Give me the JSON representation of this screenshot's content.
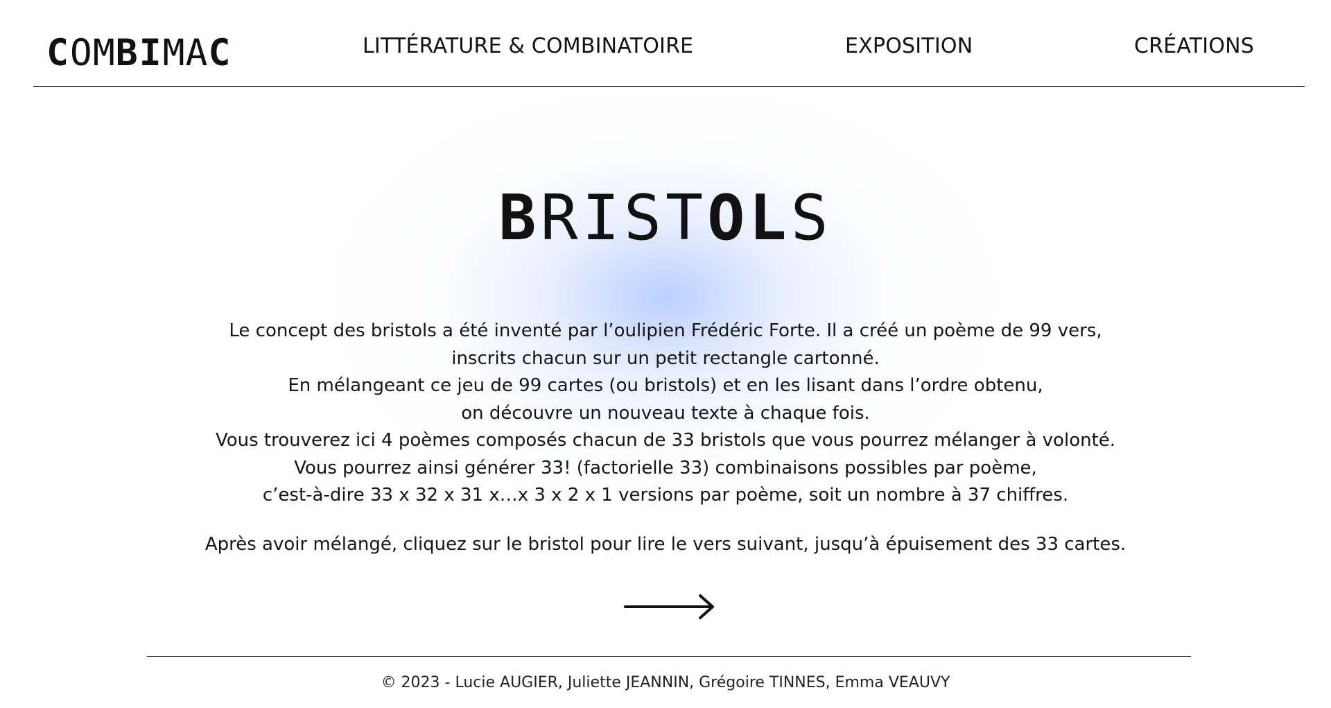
{
  "header": {
    "logo_letters": [
      "C",
      "O",
      "M",
      "B",
      "I",
      "M",
      "A",
      "C"
    ],
    "nav": [
      {
        "label": "LITTÉRATURE & COMBINATOIRE"
      },
      {
        "label": "EXPOSITION"
      },
      {
        "label": "CRÉATIONS"
      }
    ]
  },
  "main": {
    "title_letters": [
      "B",
      "R",
      "I",
      "S",
      "T",
      "O",
      "L",
      "S"
    ],
    "intro_lines": [
      "Le concept des bristols a été inventé par l’oulipien Frédéric Forte. Il a créé un poème de 99 vers,",
      "inscrits chacun sur un petit rectangle cartonné.",
      "En mélangeant ce jeu de 99 cartes (ou bristols) et en les lisant dans l’ordre obtenu,",
      "on découvre un nouveau texte à chaque fois.",
      "Vous trouverez ici 4 poèmes composés chacun de 33 bristols que vous pourrez mélanger à volonté.",
      "Vous pourrez ainsi générer 33! (factorielle 33) combinaisons possibles par poème,",
      "c’est-à-dire 33 x 32 x 31 x…x 3 x 2 x 1 versions par poème, soit un nombre à 37 chiffres."
    ],
    "instruction": "Après avoir mélangé, cliquez sur le bristol pour lire le vers suivant, jusqu’à épuisement des 33 cartes.",
    "next_icon": "arrow-right-icon"
  },
  "footer": {
    "copyright": "© 2023 - Lucie AUGIER, Juliette JEANNIN, Grégoire TINNES, Emma VEAUVY"
  },
  "colors": {
    "text": "#111111",
    "background": "#ffffff",
    "glow": "#aac3ff"
  }
}
